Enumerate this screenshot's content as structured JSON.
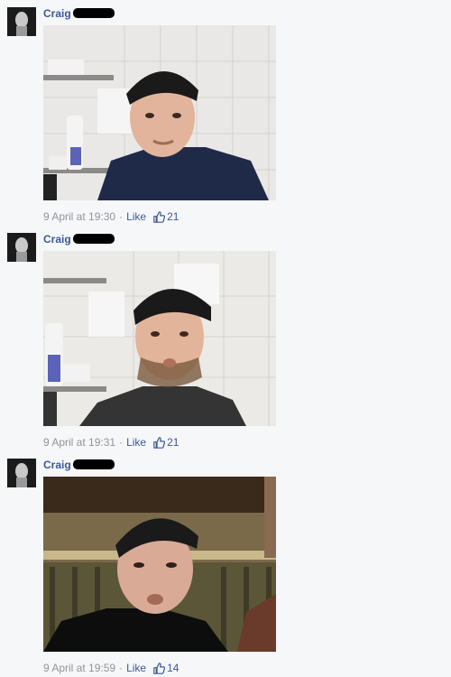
{
  "posts": [
    {
      "author": "Craig",
      "time": "9 April at 19:30",
      "separator": "·",
      "like_label": "Like",
      "like_count": "21"
    },
    {
      "author": "Craig",
      "time": "9 April at 19:31",
      "separator": "·",
      "like_label": "Like",
      "like_count": "21"
    },
    {
      "author": "Craig",
      "time": "9 April at 19:59",
      "separator": "·",
      "like_label": "Like",
      "like_count": "14"
    }
  ],
  "colors": {
    "link": "#3b5998",
    "meta": "#90949c",
    "background": "#f6f7f9"
  },
  "icons": {
    "avatar": "profile-avatar",
    "like": "thumbs-up-icon"
  }
}
